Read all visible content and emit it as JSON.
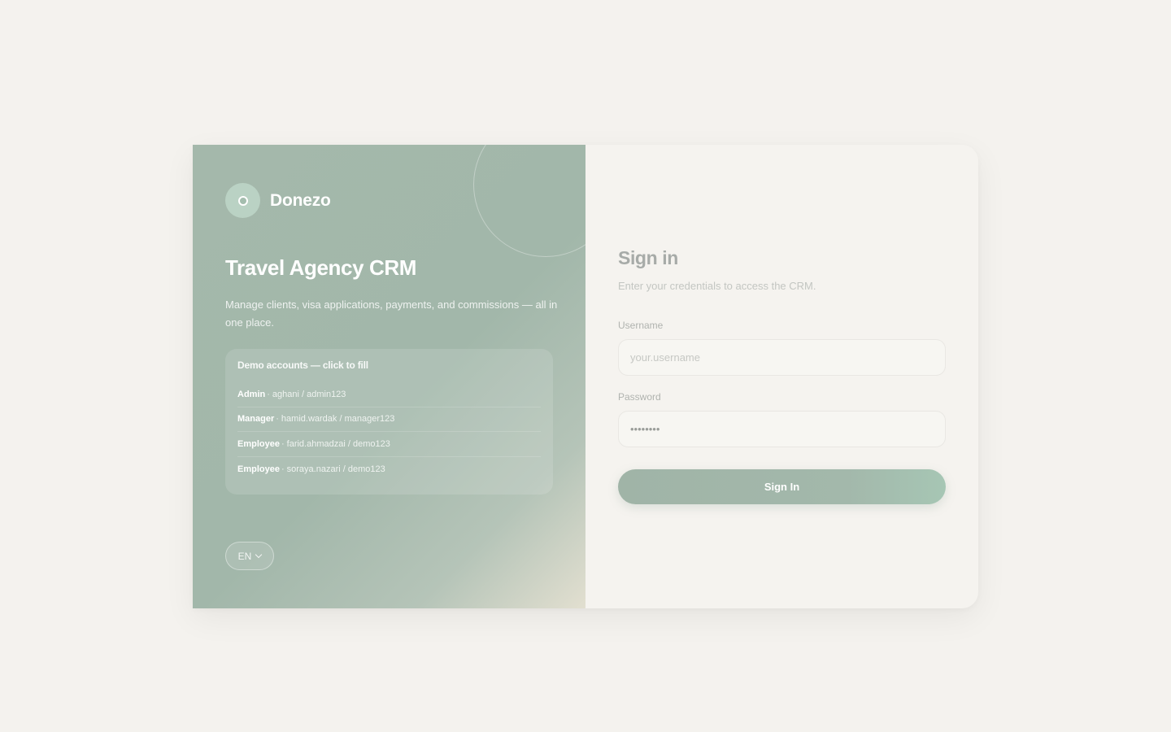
{
  "brand": {
    "name": "Donezo",
    "logo_icon": "ring-dot-icon"
  },
  "hero": {
    "title": "Travel Agency CRM",
    "subtitle": "Manage clients, visa applications, payments, and commissions — all in one place."
  },
  "demo_accounts": {
    "title": "Demo accounts — click to fill",
    "separator": "·",
    "accounts": [
      {
        "role": "Admin",
        "credentials": "aghani / admin123"
      },
      {
        "role": "Manager",
        "credentials": "hamid.wardak / manager123"
      },
      {
        "role": "Employee",
        "credentials": "farid.ahmadzai / demo123"
      },
      {
        "role": "Employee",
        "credentials": "soraya.nazari / demo123"
      }
    ]
  },
  "language": {
    "selected": "EN",
    "icon": "chevron-down-icon"
  },
  "form": {
    "title": "Sign in",
    "subtitle": "Enter your credentials to access the CRM.",
    "username_label": "Username",
    "username_placeholder": "your.username",
    "username_value": "",
    "password_label": "Password",
    "password_value": "demo1234",
    "submit_label": "Sign In"
  },
  "colors": {
    "panel_green": "#a4b8ab",
    "page_background": "#f4f2ee",
    "button": "#a2b6a9"
  }
}
